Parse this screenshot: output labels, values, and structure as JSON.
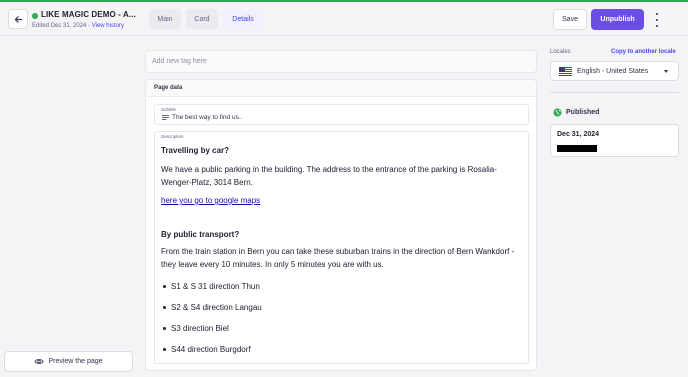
{
  "colors": {
    "accent": "#4945ff",
    "primary_button": "#6c4fe0",
    "published_green": "#32a852"
  },
  "header": {
    "back_icon": "arrow-left-icon",
    "title": "LIKE MAGIC DEMO - A...",
    "edited_text": "Edited Dec 31, 2024 - ",
    "view_history": "View history",
    "tabs": [
      {
        "label": "Main",
        "active": false
      },
      {
        "label": "Card",
        "active": false
      },
      {
        "label": "Details",
        "active": true
      }
    ],
    "save_label": "Save",
    "unpublish_label": "Unpublish",
    "more_icon": "more-vertical-icon"
  },
  "sidebar_left": {
    "preview_icon": "eye-icon",
    "preview_label": "Preview the page"
  },
  "main": {
    "tag_placeholder": "Add new tag here",
    "panel_title": "Page data",
    "subtitle": {
      "label": "Subtitle",
      "icon": "text-lines-icon",
      "value": "The best way to find us.."
    },
    "description": {
      "label": "Description",
      "heading_car": "Travelling by car?",
      "para_car": "We have a public parking in the building. The address to the entrance of the parking is Rosalia-Wenger-Platz, 3014 Bern.",
      "maps_link": "here you go to google maps",
      "heading_transport": "By public transport?",
      "para_transport": "From the train station in Bern you can take these suburban trains in the direction of Bern Wankdorf - they leave every 10 minutes. In only 5 minutes you are with us.",
      "trains": [
        "S1 & S 31 direction Thun",
        "S2 & S4 direction Langau",
        "S3 direction Biel",
        "S44 direction Burgdorf"
      ]
    }
  },
  "sidebar_right": {
    "locales_label": "Locales",
    "copy_locale": "Copy to another locale",
    "locale_flag": "us-flag-icon",
    "locale_value": "English - United States",
    "published_icon": "globe-icon",
    "published_label": "Published",
    "published_date": "Dec 31, 2024"
  }
}
